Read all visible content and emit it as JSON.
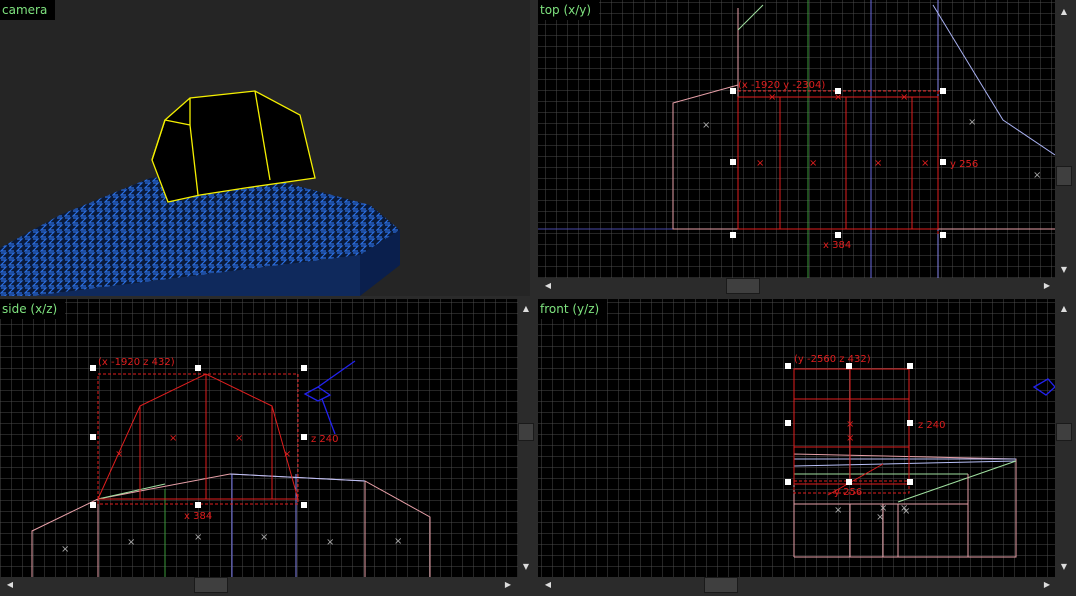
{
  "viewports": {
    "camera": {
      "label": "camera"
    },
    "top": {
      "label": "top (x/y)",
      "origin_label": "(x -1920 y -2304)",
      "width_label": "x 384",
      "height_label": "y 256"
    },
    "side": {
      "label": "side (x/z)",
      "origin_label": "(x -1920 z 432)",
      "width_label": "x 384",
      "height_label": "z 240"
    },
    "front": {
      "label": "front (y/z)",
      "origin_label": "(y -2560 z 432)",
      "width_label": "y 256",
      "height_label": "z 240"
    }
  },
  "scroll_icons": {
    "up": "▲",
    "down": "▼",
    "left": "◀",
    "right": "▶"
  },
  "colors": {
    "background": "#2b2b2b",
    "viewport_bg": "#000000",
    "label_text": "#7ee27e",
    "selection": "#e01e1e",
    "brush_outline": "#e8a0a8",
    "grid": "#4a4a4a",
    "camera_brush_edge": "#f5f000",
    "texture_blue": "#1e5fd8",
    "entity_blue": "#2222ee"
  }
}
